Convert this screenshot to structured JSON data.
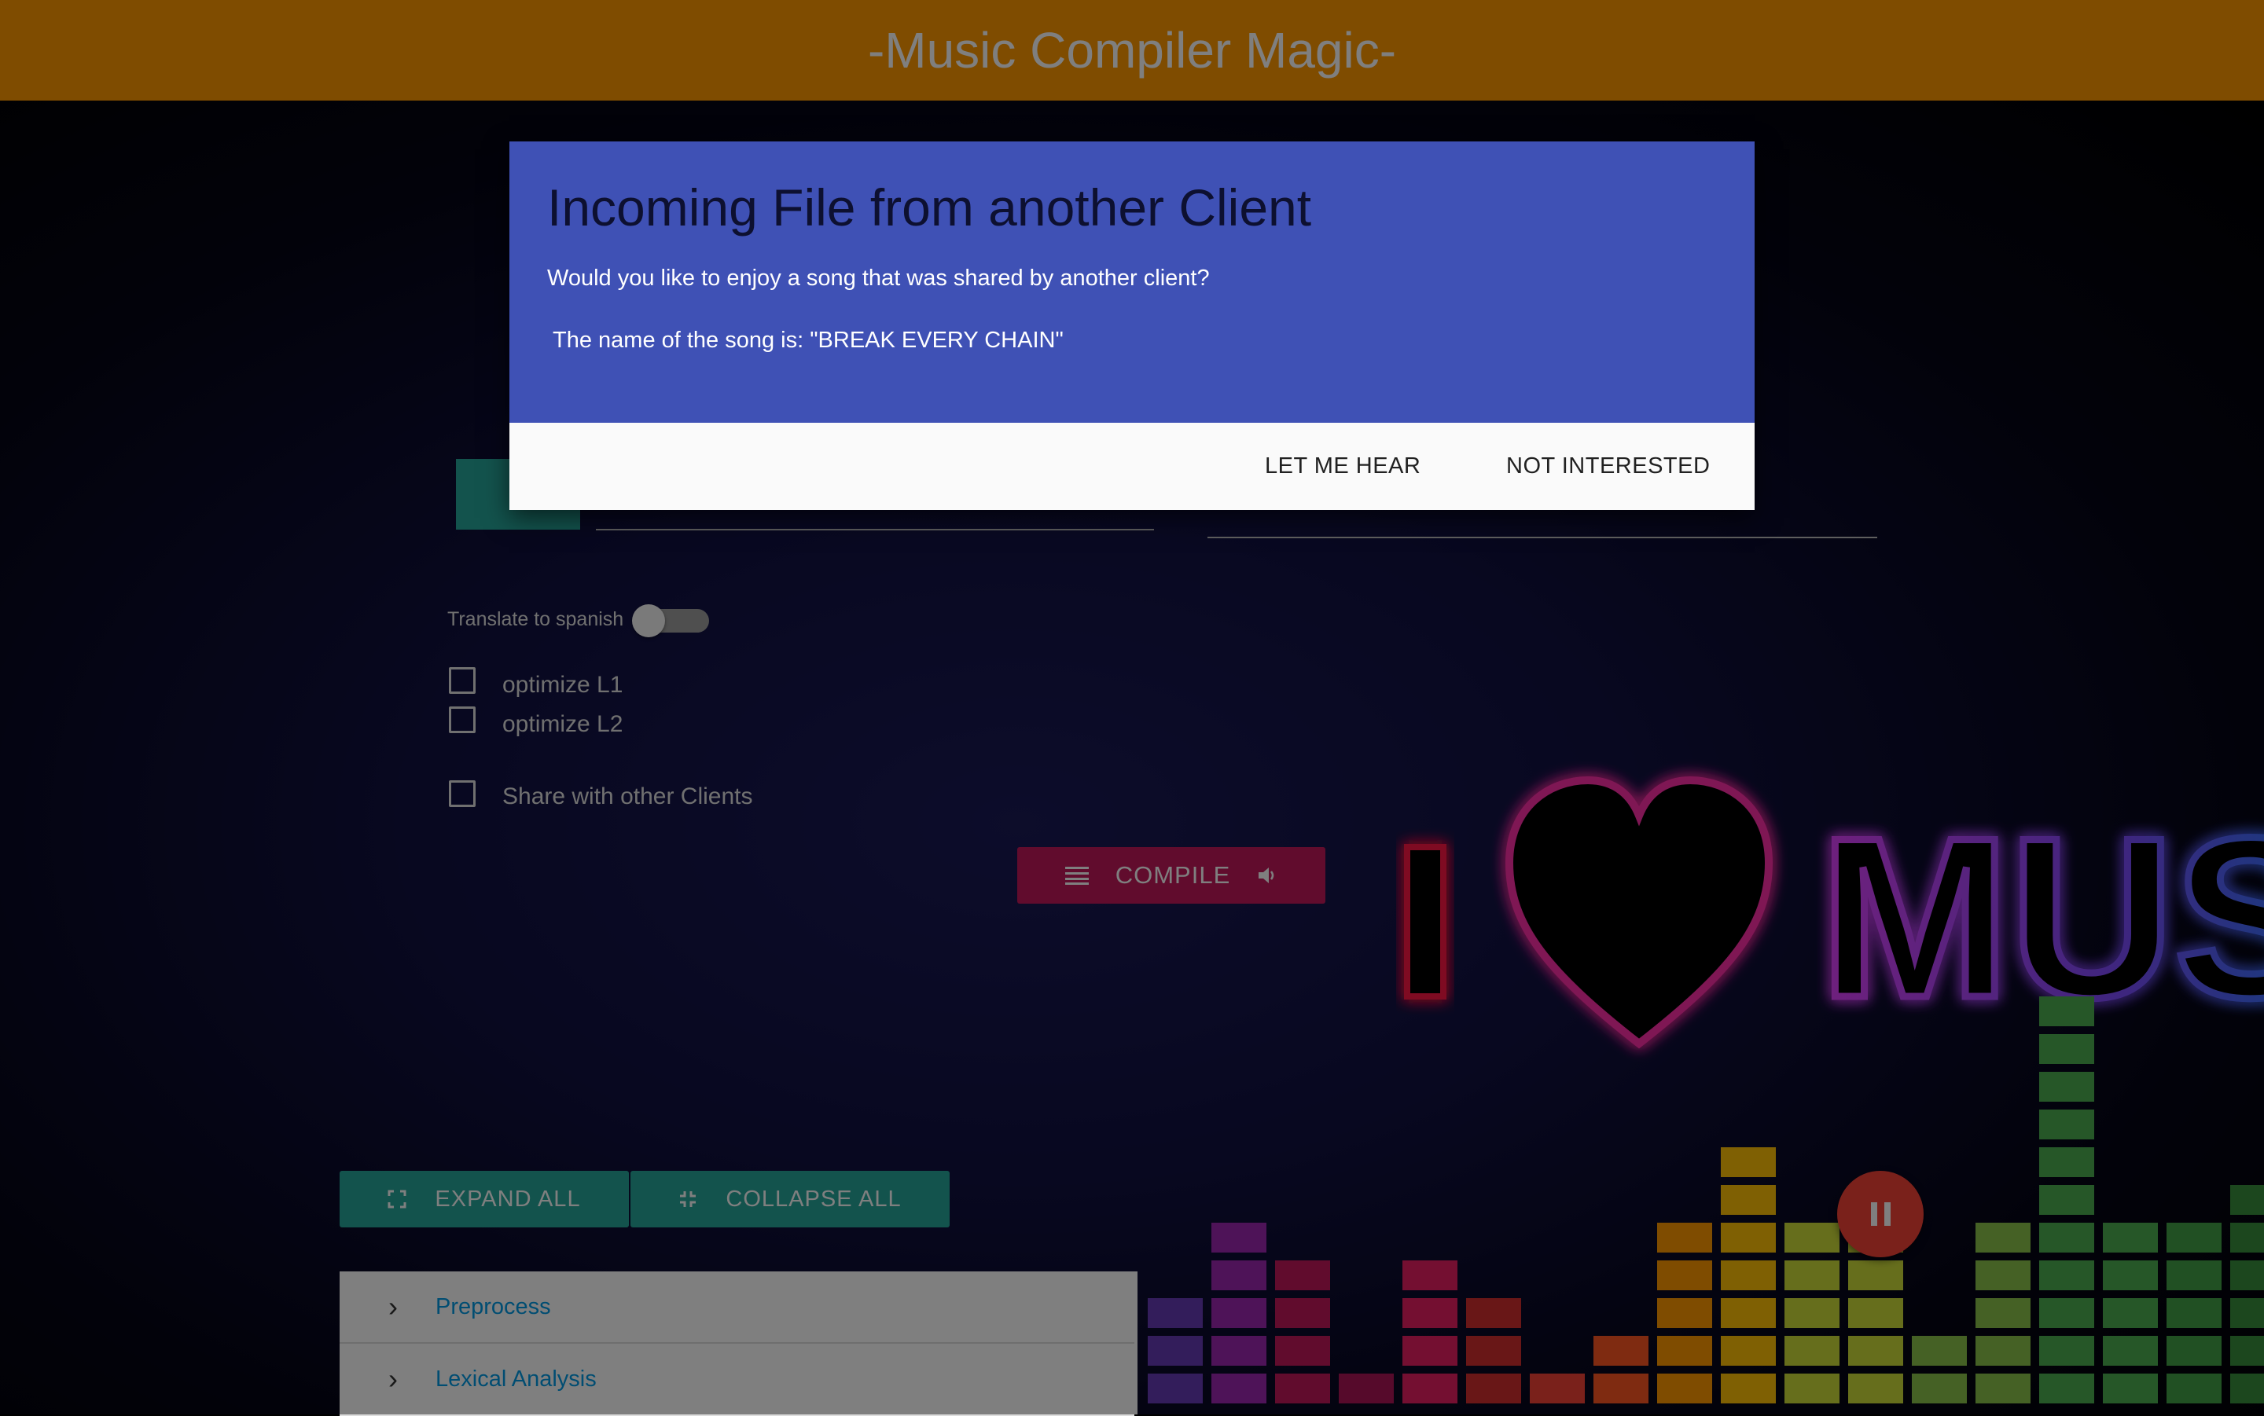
{
  "header": {
    "title": "-Music Compiler Magic-"
  },
  "options": {
    "translate_label": "Translate to spanish",
    "checkboxes": [
      "optimize L1",
      "optimize L2"
    ],
    "share_label": "Share with other Clients"
  },
  "compile": {
    "label": "COMPILE",
    "left_icon": "list-icon",
    "right_icon": "volume-icon"
  },
  "banner": {
    "text": "I ♥ MUS"
  },
  "actions": {
    "expand_label": "EXPAND ALL",
    "expand_icon": "fullscreen-icon",
    "collapse_label": "COLLAPSE ALL",
    "collapse_icon": "fullscreen-exit-icon"
  },
  "sections": [
    "Preprocess",
    "Lexical Analysis"
  ],
  "fab": {
    "icon": "pause-icon"
  },
  "modal": {
    "title": "Incoming File from another Client",
    "question": "Would you like to enjoy a song that was shared by another client?",
    "song_line": "The name of the song is: \"BREAK EVERY CHAIN\"",
    "accept_label": "LET ME HEAR",
    "decline_label": "NOT INTERESTED"
  },
  "colors": {
    "header": "#ff9800",
    "modal": "#3f51b5",
    "teal": "#26a69a",
    "compile": "#c2185b",
    "fab": "#f44336"
  }
}
